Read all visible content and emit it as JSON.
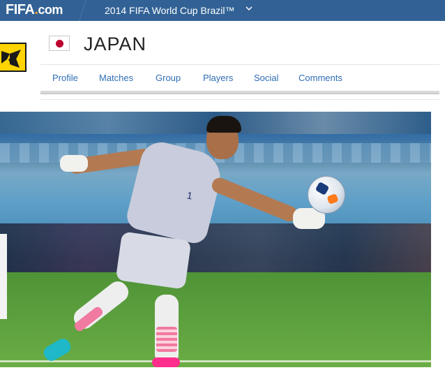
{
  "topbar": {
    "logo_main": "FIFA",
    "logo_dot": ".",
    "logo_com": "com",
    "edition": "2014 FIFA World Cup Brazil™",
    "edition_chevron": "chevron-down-icon",
    "bg_color": "#326295"
  },
  "team": {
    "name": "JAPAN",
    "flag_icon": "japan-flag-icon",
    "badge_icon": "team-crest-icon"
  },
  "nav": {
    "items": [
      {
        "label": "Profile"
      },
      {
        "label": "Matches"
      },
      {
        "label": "Group"
      },
      {
        "label": "Players"
      },
      {
        "label": "Social"
      },
      {
        "label": "Comments"
      }
    ],
    "link_color": "#2f6db5"
  },
  "hero": {
    "image": "goalkeeper-throwing-ball-photo"
  }
}
